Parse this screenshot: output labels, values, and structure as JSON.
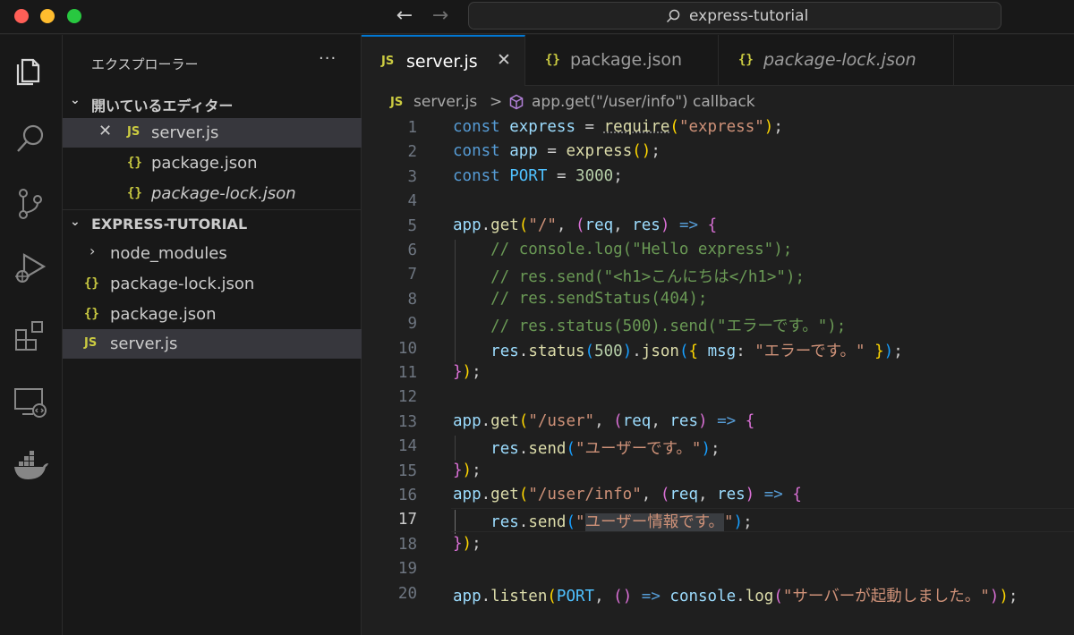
{
  "window": {
    "search_text": "express-tutorial"
  },
  "activitybar": {
    "items": [
      {
        "name": "explorer-icon"
      },
      {
        "name": "search-icon"
      },
      {
        "name": "source-control-icon"
      },
      {
        "name": "run-debug-icon"
      },
      {
        "name": "extensions-icon"
      },
      {
        "name": "remote-explorer-icon"
      },
      {
        "name": "docker-icon"
      }
    ]
  },
  "sidebar": {
    "title": "エクスプローラー",
    "more": "···",
    "open_editors": {
      "label": "開いているエディター",
      "items": [
        {
          "icon": "JS",
          "name": "server.js",
          "italic": false
        },
        {
          "icon": "{}",
          "name": "package.json",
          "italic": false
        },
        {
          "icon": "{}",
          "name": "package-lock.json",
          "italic": true
        }
      ]
    },
    "project": {
      "label": "EXPRESS-TUTORIAL",
      "items": [
        {
          "icon": "folder",
          "name": "node_modules"
        },
        {
          "icon": "{}",
          "name": "package-lock.json"
        },
        {
          "icon": "{}",
          "name": "package.json"
        },
        {
          "icon": "JS",
          "name": "server.js"
        }
      ]
    }
  },
  "tabs": [
    {
      "icon": "JS",
      "label": "server.js",
      "active": true
    },
    {
      "icon": "{}",
      "label": "package.json",
      "active": false
    },
    {
      "icon": "{}",
      "label": "package-lock.json",
      "active": false
    }
  ],
  "breadcrumb": {
    "icon": "JS",
    "file": "server.js",
    "sep": ">",
    "symbol": "app.get(\"/user/info\") callback"
  },
  "editor": {
    "current_line": 17,
    "line_numbers": [
      "1",
      "2",
      "3",
      "4",
      "5",
      "6",
      "7",
      "8",
      "9",
      "10",
      "11",
      "12",
      "13",
      "14",
      "15",
      "16",
      "17",
      "18",
      "19",
      "20"
    ]
  },
  "colors": {
    "accent": "#0078d4",
    "js_icon": "#cbcb41"
  }
}
